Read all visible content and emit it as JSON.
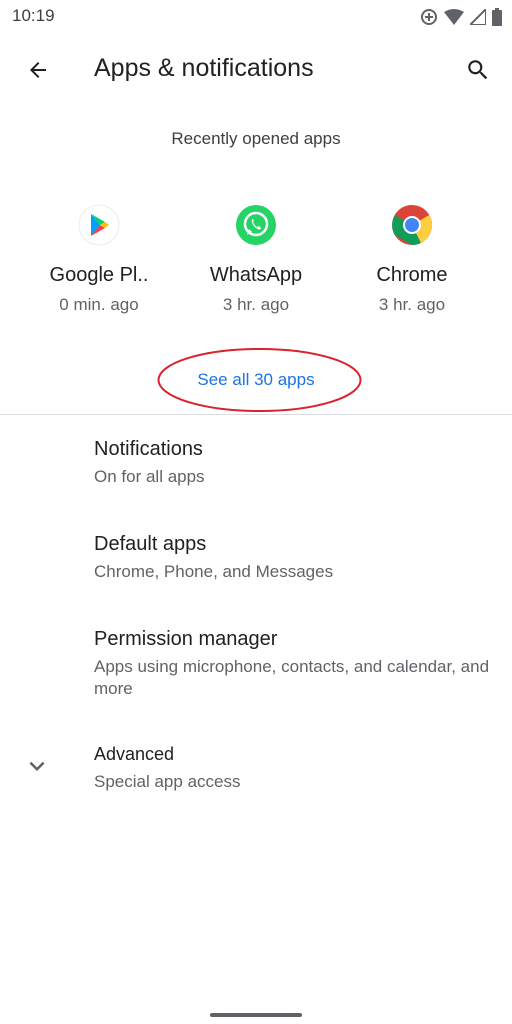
{
  "status_bar": {
    "time": "10:19"
  },
  "app_bar": {
    "title": "Apps & notifications"
  },
  "recent": {
    "header": "Recently opened apps",
    "apps": [
      {
        "name": "Google Pl..",
        "time": "0 min. ago",
        "icon": "google-play-icon"
      },
      {
        "name": "WhatsApp",
        "time": "3 hr. ago",
        "icon": "whatsapp-icon"
      },
      {
        "name": "Chrome",
        "time": "3 hr. ago",
        "icon": "chrome-icon"
      }
    ],
    "see_all": "See all 30 apps"
  },
  "prefs": [
    {
      "title": "Notifications",
      "summary": "On for all apps"
    },
    {
      "title": "Default apps",
      "summary": "Chrome, Phone, and Messages"
    },
    {
      "title": "Permission manager",
      "summary": "Apps using microphone, contacts, and calendar, and more"
    },
    {
      "title": "Advanced",
      "summary": "Special app access"
    }
  ],
  "colors": {
    "accent": "#1a73e8",
    "annotation": "#d9232d",
    "text": "#202124",
    "secondary": "#5f6368"
  }
}
